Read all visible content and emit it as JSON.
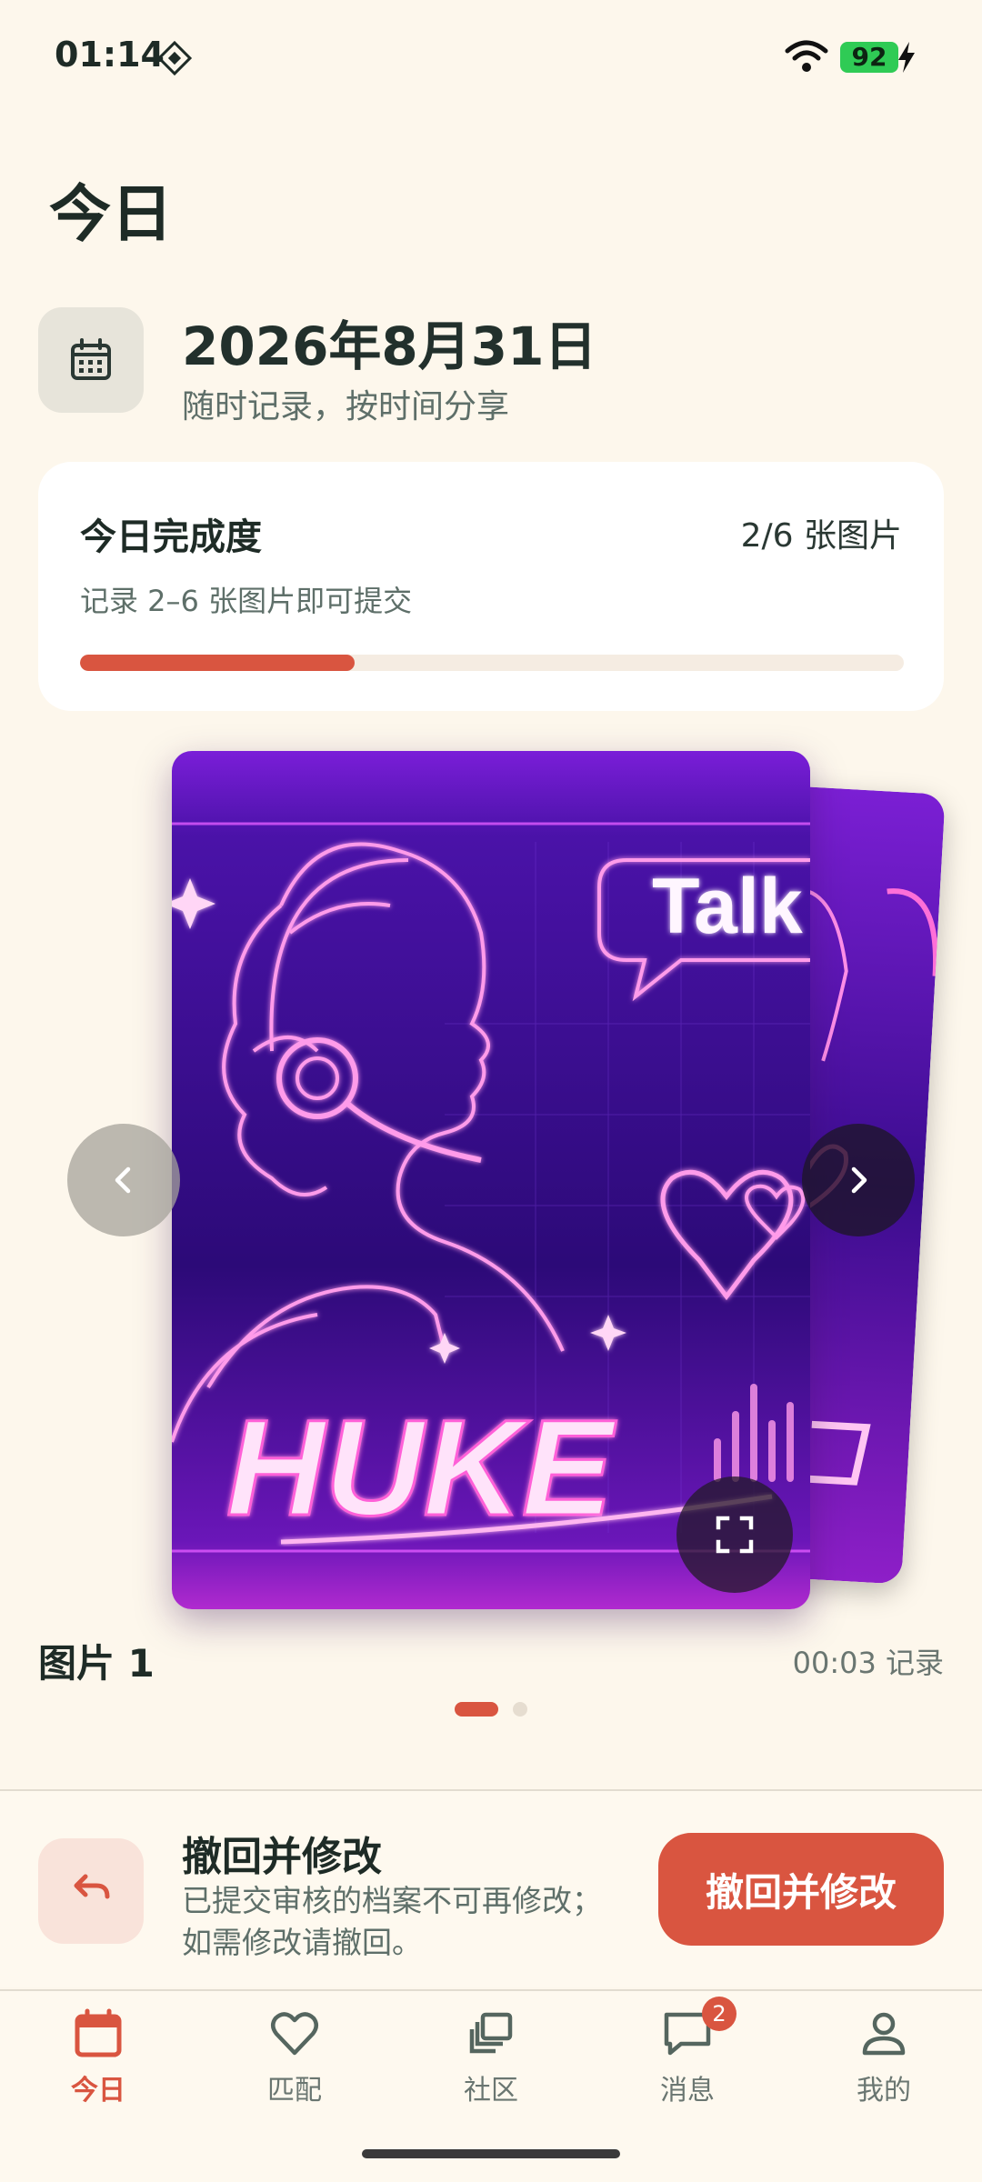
{
  "status_bar": {
    "time": "01:14",
    "battery": "92"
  },
  "header": {
    "title": "今日"
  },
  "date_section": {
    "date": "2026年8月31日",
    "subtitle": "随时记录，按时间分享"
  },
  "progress_card": {
    "title": "今日完成度",
    "count": "2/6 张图片",
    "hint": "记录 2–6 张图片即可提交",
    "progress": 0.333
  },
  "carousel": {
    "poster_brand": "HUKE",
    "poster_bubble": "Talk",
    "image_label": "图片 1",
    "image_time": "00:03 记录",
    "page_index": 1,
    "page_total": 2
  },
  "banner": {
    "title": "撤回并修改",
    "description": "已提交审核的档案不可再修改；如需修改请撤回。",
    "button_label": "撤回并修改"
  },
  "tabbar": {
    "items": [
      {
        "label": "今日",
        "icon": "calendar-icon",
        "active": true
      },
      {
        "label": "匹配",
        "icon": "heart-icon",
        "active": false
      },
      {
        "label": "社区",
        "icon": "stack-icon",
        "active": false
      },
      {
        "label": "消息",
        "icon": "chat-icon",
        "active": false,
        "badge": "2"
      },
      {
        "label": "我的",
        "icon": "person-icon",
        "active": false
      }
    ]
  },
  "colors": {
    "accent": "#D95540",
    "background": "#FDF7EC",
    "battery": "#2FCB55"
  }
}
